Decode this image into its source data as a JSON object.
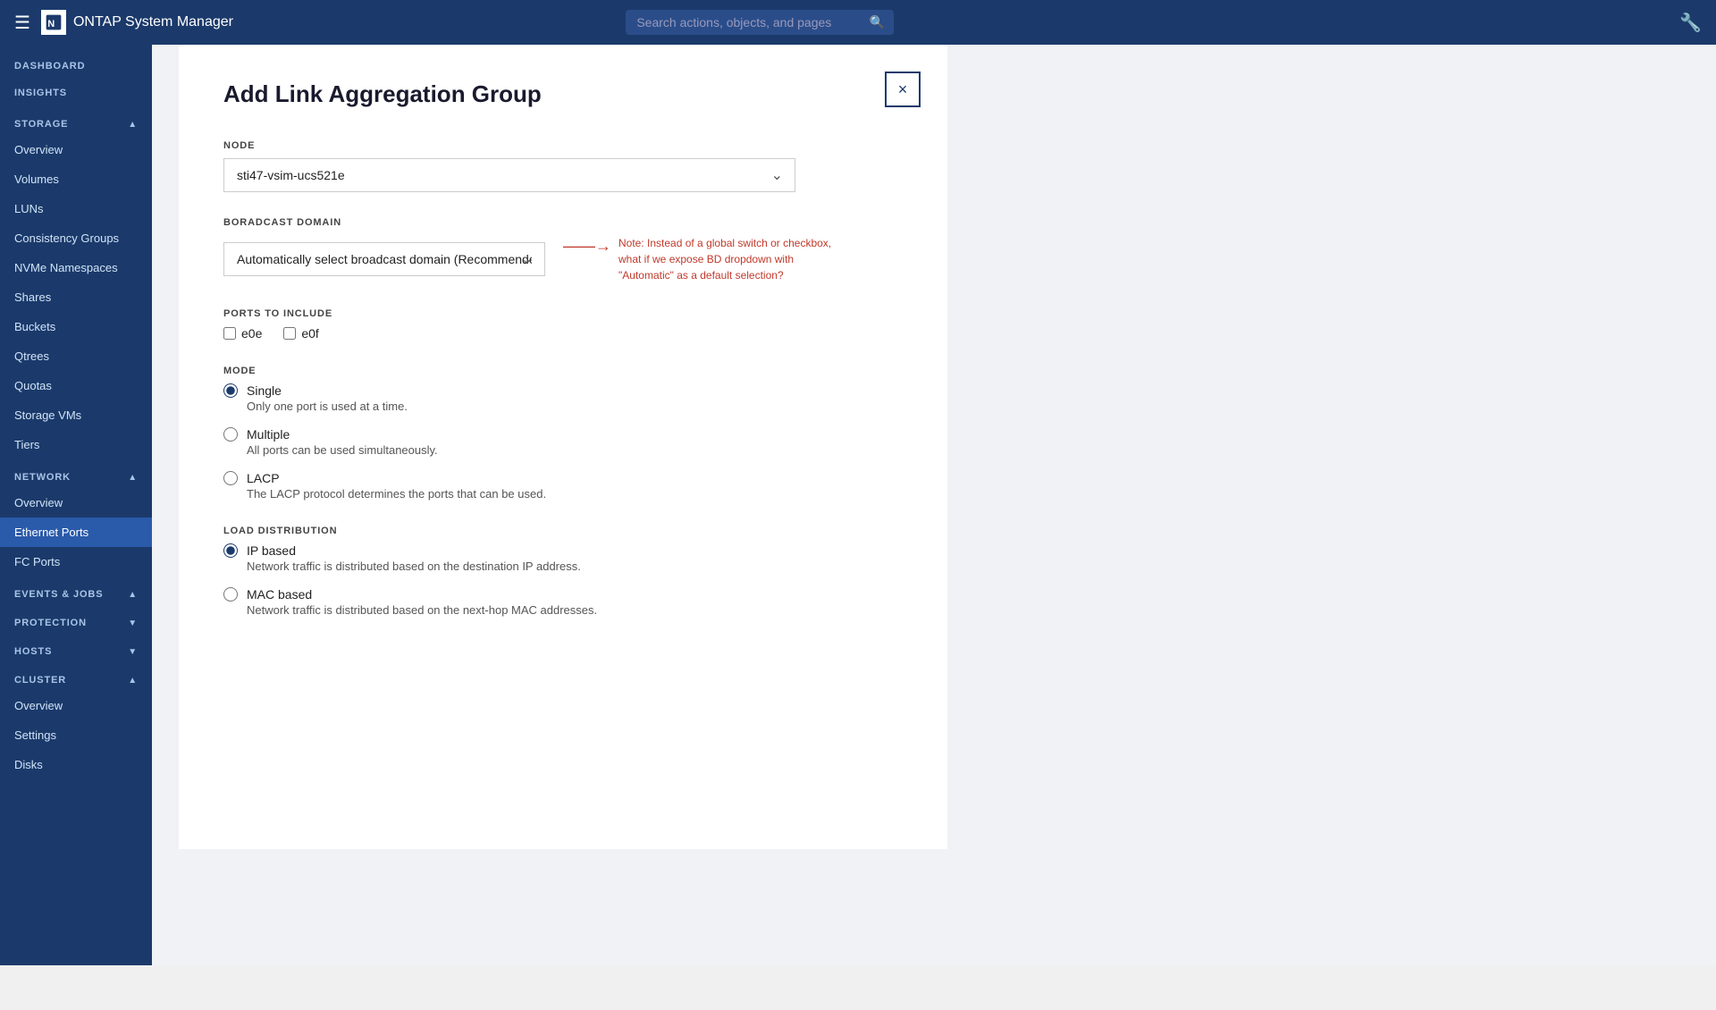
{
  "topnav": {
    "hamburger": "☰",
    "logo_icon_text": "N",
    "app_title": "ONTAP System Manager",
    "search_placeholder": "Search actions, objects, and pages",
    "settings_icon": "⚙"
  },
  "sidebar": {
    "dashboard_label": "DASHBOARD",
    "insights_label": "INSIGHTS",
    "storage": {
      "header": "STORAGE",
      "items": [
        {
          "label": "Overview",
          "active": false
        },
        {
          "label": "Volumes",
          "active": false
        },
        {
          "label": "LUNs",
          "active": false
        },
        {
          "label": "Consistency Groups",
          "active": false
        },
        {
          "label": "NVMe Namespaces",
          "active": false
        },
        {
          "label": "Shares",
          "active": false
        },
        {
          "label": "Buckets",
          "active": false
        },
        {
          "label": "Qtrees",
          "active": false
        },
        {
          "label": "Quotas",
          "active": false
        },
        {
          "label": "Storage VMs",
          "active": false
        },
        {
          "label": "Tiers",
          "active": false
        }
      ]
    },
    "network": {
      "header": "NETWORK",
      "items": [
        {
          "label": "Overview",
          "active": false
        },
        {
          "label": "Ethernet Ports",
          "active": true
        },
        {
          "label": "FC Ports",
          "active": false
        }
      ]
    },
    "events_jobs": {
      "header": "EVENTS & JOBS"
    },
    "protection": {
      "header": "PROTECTION"
    },
    "hosts": {
      "header": "HOSTS"
    },
    "cluster": {
      "header": "CLUSTER",
      "items": [
        {
          "label": "Overview",
          "active": false
        },
        {
          "label": "Settings",
          "active": false
        },
        {
          "label": "Disks",
          "active": false
        }
      ]
    }
  },
  "modal": {
    "title": "Add Link Aggregation Group",
    "close_label": "×",
    "node_label": "NODE",
    "node_value": "sti47-vsim-ucs521e",
    "broadcast_domain_label": "BORADCAST DOMAIN",
    "broadcast_domain_value": "Automatically select broadcast domain (Recommended)",
    "broadcast_note": "Note: Instead of a global switch or checkbox, what if we expose BD dropdown with \"Automatic\" as a default selection?",
    "ports_label": "PORTS TO INCLUDE",
    "ports": [
      {
        "id": "e0e",
        "label": "e0e",
        "checked": false
      },
      {
        "id": "e0f",
        "label": "e0f",
        "checked": false
      }
    ],
    "mode_label": "MODE",
    "modes": [
      {
        "id": "single",
        "label": "Single",
        "desc": "Only one port is used at a time.",
        "checked": true
      },
      {
        "id": "multiple",
        "label": "Multiple",
        "desc": "All ports can be used simultaneously.",
        "checked": false
      },
      {
        "id": "lacp",
        "label": "LACP",
        "desc": "The LACP protocol determines the ports that can be used.",
        "checked": false
      }
    ],
    "load_dist_label": "LOAD DISTRIBUTION",
    "load_dists": [
      {
        "id": "ip_based",
        "label": "IP based",
        "desc": "Network traffic is distributed based on the destination IP address.",
        "checked": true
      },
      {
        "id": "mac_based",
        "label": "MAC based",
        "desc": "Network traffic is distributed based on the next-hop MAC addresses.",
        "checked": false
      }
    ]
  }
}
